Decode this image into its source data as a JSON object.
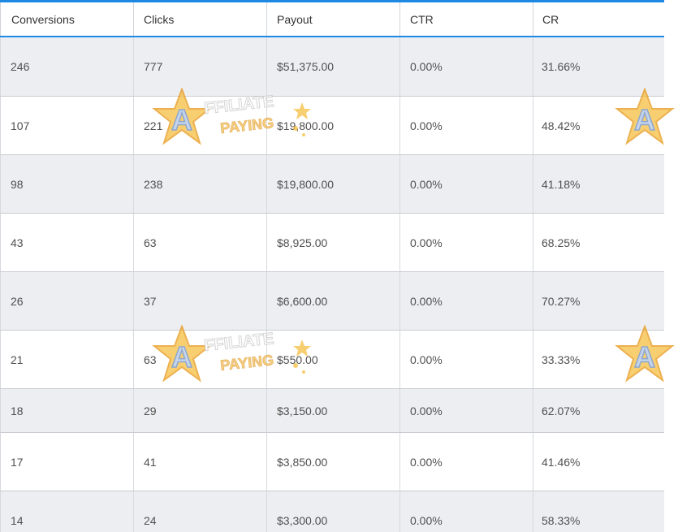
{
  "columns": [
    "Conversions",
    "Clicks",
    "Payout",
    "CTR",
    "CR"
  ],
  "rows": [
    [
      "246",
      "777",
      "$51,375.00",
      "0.00%",
      "31.66%"
    ],
    [
      "107",
      "221",
      "$19,800.00",
      "0.00%",
      "48.42%"
    ],
    [
      "98",
      "238",
      "$19,800.00",
      "0.00%",
      "41.18%"
    ],
    [
      "43",
      "63",
      "$8,925.00",
      "0.00%",
      "68.25%"
    ],
    [
      "26",
      "37",
      "$6,600.00",
      "0.00%",
      "70.27%"
    ],
    [
      "21",
      "63",
      "$550.00",
      "0.00%",
      "33.33%"
    ],
    [
      "18",
      "29",
      "$3,150.00",
      "0.00%",
      "62.07%"
    ],
    [
      "17",
      "41",
      "$3,850.00",
      "0.00%",
      "41.46%"
    ],
    [
      "14",
      "24",
      "$3,300.00",
      "0.00%",
      "58.33%"
    ]
  ],
  "watermark": {
    "line1": "FFILIATE",
    "line2": "PAYING",
    "letter": "A"
  },
  "colors": {
    "accent": "#1e88e5",
    "row_shaded": "#eceef1",
    "row_plain": "#ffffff"
  }
}
